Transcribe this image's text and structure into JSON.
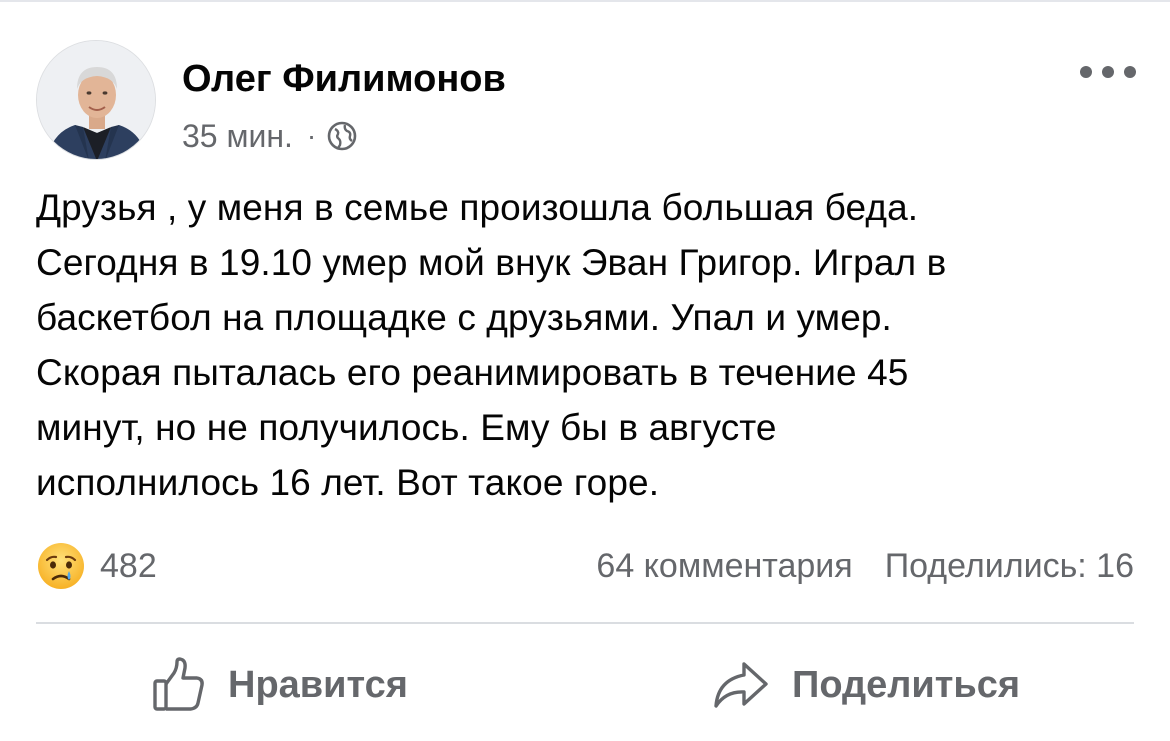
{
  "post": {
    "author": "Олег Филимонов",
    "time": "35 мин.",
    "separator": "·",
    "privacy_icon": "globe-icon",
    "more_icon": "more-options-icon",
    "text_lines": [
      "Друзья , у меня в семье произошла большая беда.",
      "Сегодня в 19.10 умер мой внук Эван Григор. Играл в",
      "баскетбол на площадке с друзьями. Упал и умер.",
      "Скорая пыталась его реанимировать в течение 45",
      "минут, но не получилось.  Ему бы в августе",
      "исполнилось 16 лет. Вот такое горе."
    ]
  },
  "stats": {
    "reaction_icon": "sad-emoji-icon",
    "reactions": "482",
    "comments": "64 комментария",
    "shares": "Поделились: 16"
  },
  "actions": {
    "like_label": "Нравится",
    "like_icon": "thumbs-up-icon",
    "share_label": "Поделиться",
    "share_icon": "share-arrow-icon"
  },
  "colors": {
    "text_primary": "#050505",
    "text_secondary": "#65676b",
    "divider": "#dadde1"
  }
}
